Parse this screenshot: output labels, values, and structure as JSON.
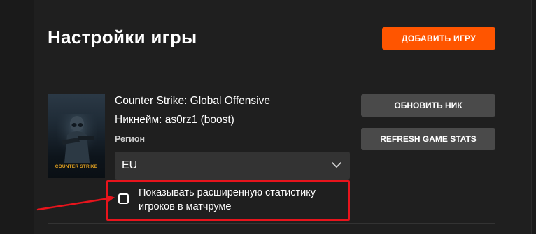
{
  "page": {
    "title": "Настройки игры",
    "add_game_label": "ДОБАВИТЬ ИГРУ"
  },
  "game": {
    "name": "Counter Strike: Global Offensive",
    "nickname": "Никнейм: as0rz1 (boost)",
    "cover_logo": "COUNTER STRIKE",
    "region_label": "Регион",
    "region_value": "EU",
    "stats_checkbox_label": "Показывать расширенную статистику игроков в матчруме",
    "stats_checkbox_checked": false
  },
  "actions": {
    "refresh_nick_label": "ОБНОВИТЬ НИК",
    "refresh_stats_label": "REFRESH GAME STATS"
  },
  "colors": {
    "accent": "#ff5500",
    "highlight": "#e8141c",
    "background": "#1f1f1f",
    "button_secondary": "#4a4a4a"
  }
}
